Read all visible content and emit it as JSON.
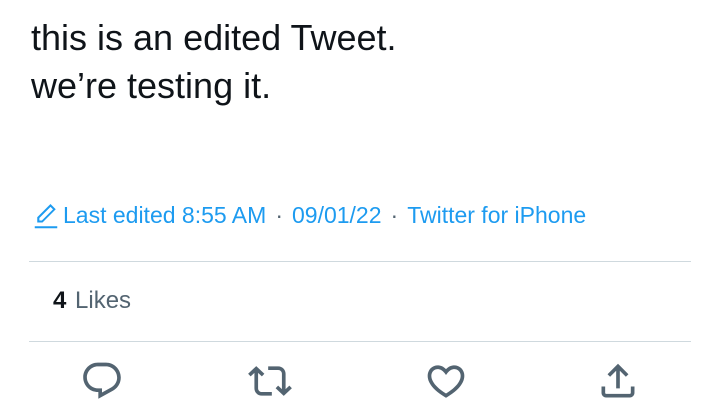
{
  "tweet": {
    "lines": [
      "this is an edited Tweet.",
      "we’re testing it."
    ]
  },
  "meta": {
    "edited_label": "Last edited 8:55 AM",
    "separator": "·",
    "date": "09/01/22",
    "source": "Twitter for iPhone"
  },
  "likes": {
    "count": "4",
    "label": "Likes"
  },
  "actions": [
    {
      "name": "reply",
      "icon": "reply-icon"
    },
    {
      "name": "retweet",
      "icon": "retweet-icon"
    },
    {
      "name": "like",
      "icon": "heart-icon"
    },
    {
      "name": "share",
      "icon": "share-icon"
    }
  ],
  "colors": {
    "link": "#1d9bf0",
    "text": "#0f1419",
    "secondary": "#536471",
    "divider": "#cfd9de"
  }
}
